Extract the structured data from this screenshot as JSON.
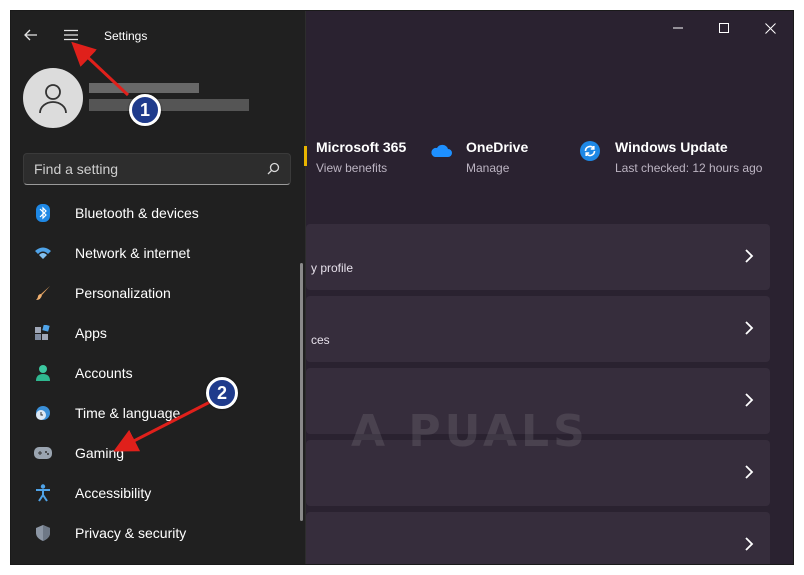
{
  "window": {
    "title": "Settings"
  },
  "search": {
    "placeholder": "Find a setting"
  },
  "nav": {
    "items": [
      {
        "label": "Bluetooth & devices",
        "icon": "bluetooth-icon"
      },
      {
        "label": "Network & internet",
        "icon": "wifi-icon"
      },
      {
        "label": "Personalization",
        "icon": "brush-icon"
      },
      {
        "label": "Apps",
        "icon": "apps-icon"
      },
      {
        "label": "Accounts",
        "icon": "person-icon"
      },
      {
        "label": "Time & language",
        "icon": "globe-clock-icon"
      },
      {
        "label": "Gaming",
        "icon": "gamepad-icon"
      },
      {
        "label": "Accessibility",
        "icon": "accessibility-icon"
      },
      {
        "label": "Privacy & security",
        "icon": "shield-icon"
      }
    ]
  },
  "services": [
    {
      "title": "Microsoft 365",
      "subtitle": "View benefits"
    },
    {
      "title": "OneDrive",
      "subtitle": "Manage"
    },
    {
      "title": "Windows Update",
      "subtitle": "Last checked: 12 hours ago"
    }
  ],
  "cards": [
    {
      "text": "y profile"
    },
    {
      "text": "ces"
    }
  ],
  "watermark": "A  PUALS",
  "annotations": {
    "badge1": "1",
    "badge2": "2"
  },
  "colors": {
    "accent": "#0078d4",
    "badge": "#1f3b8c",
    "arrow": "#e0201b"
  }
}
